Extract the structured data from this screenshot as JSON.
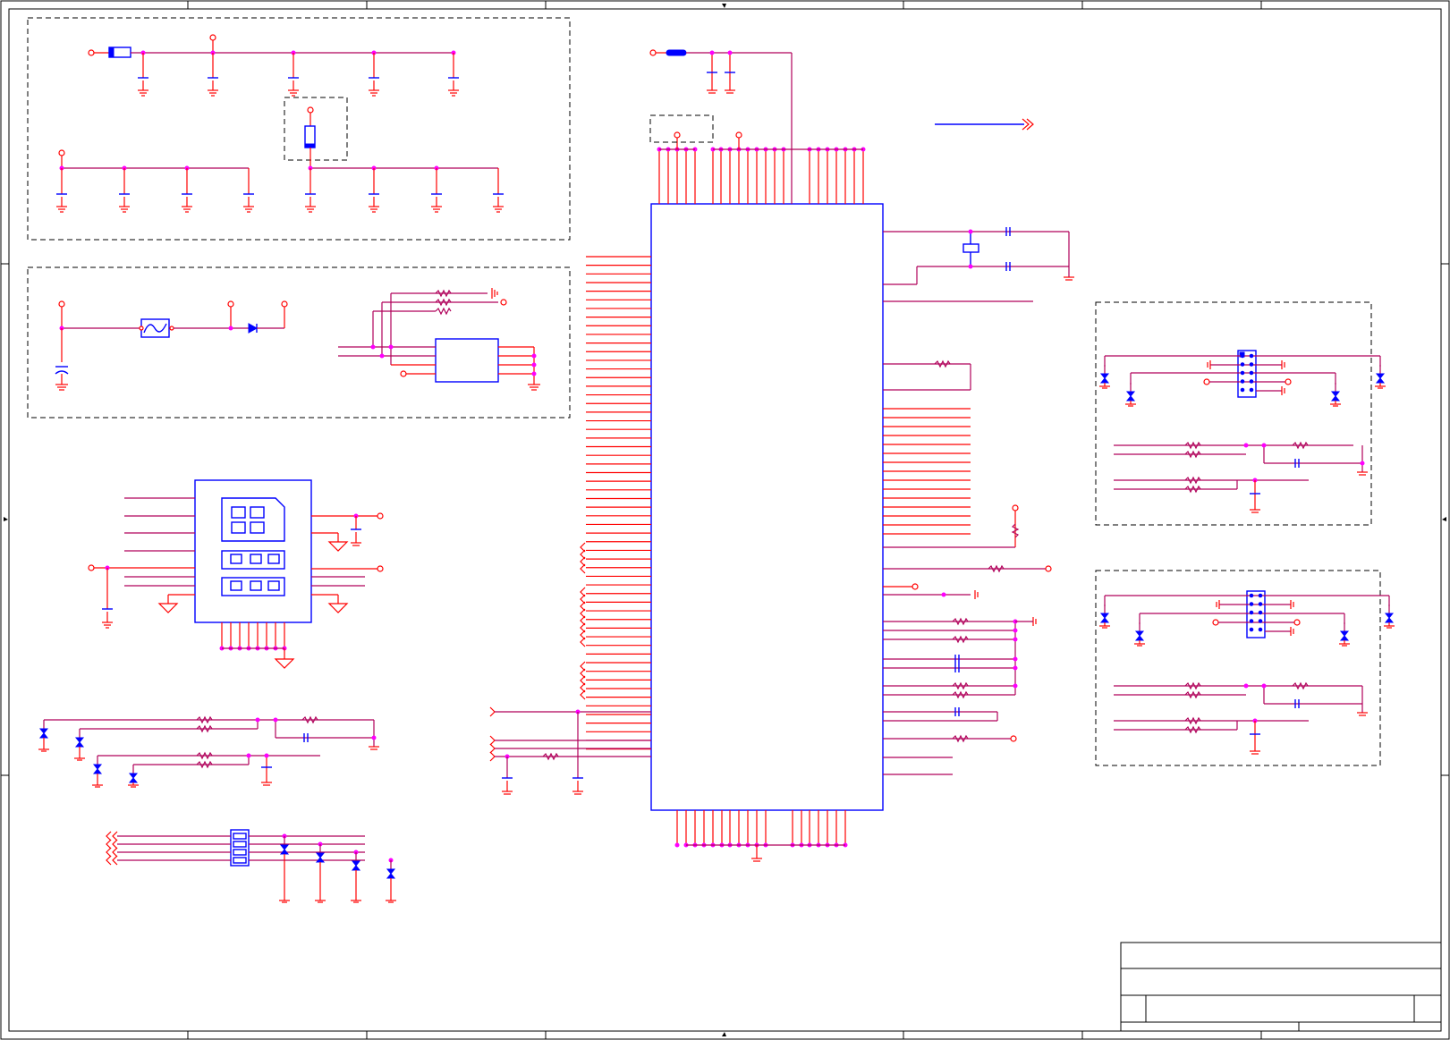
{
  "sheet": {
    "zones_top": [
      "",
      "",
      "",
      "",
      "",
      "",
      "",
      ""
    ],
    "title_block": {
      "title": "",
      "document": "",
      "size": "",
      "rev": ""
    }
  },
  "colors": {
    "wire": "#b0005a",
    "pin": "#ff0000",
    "component": "#0000ff",
    "junction": "#ff00ff",
    "border": "#000000"
  }
}
